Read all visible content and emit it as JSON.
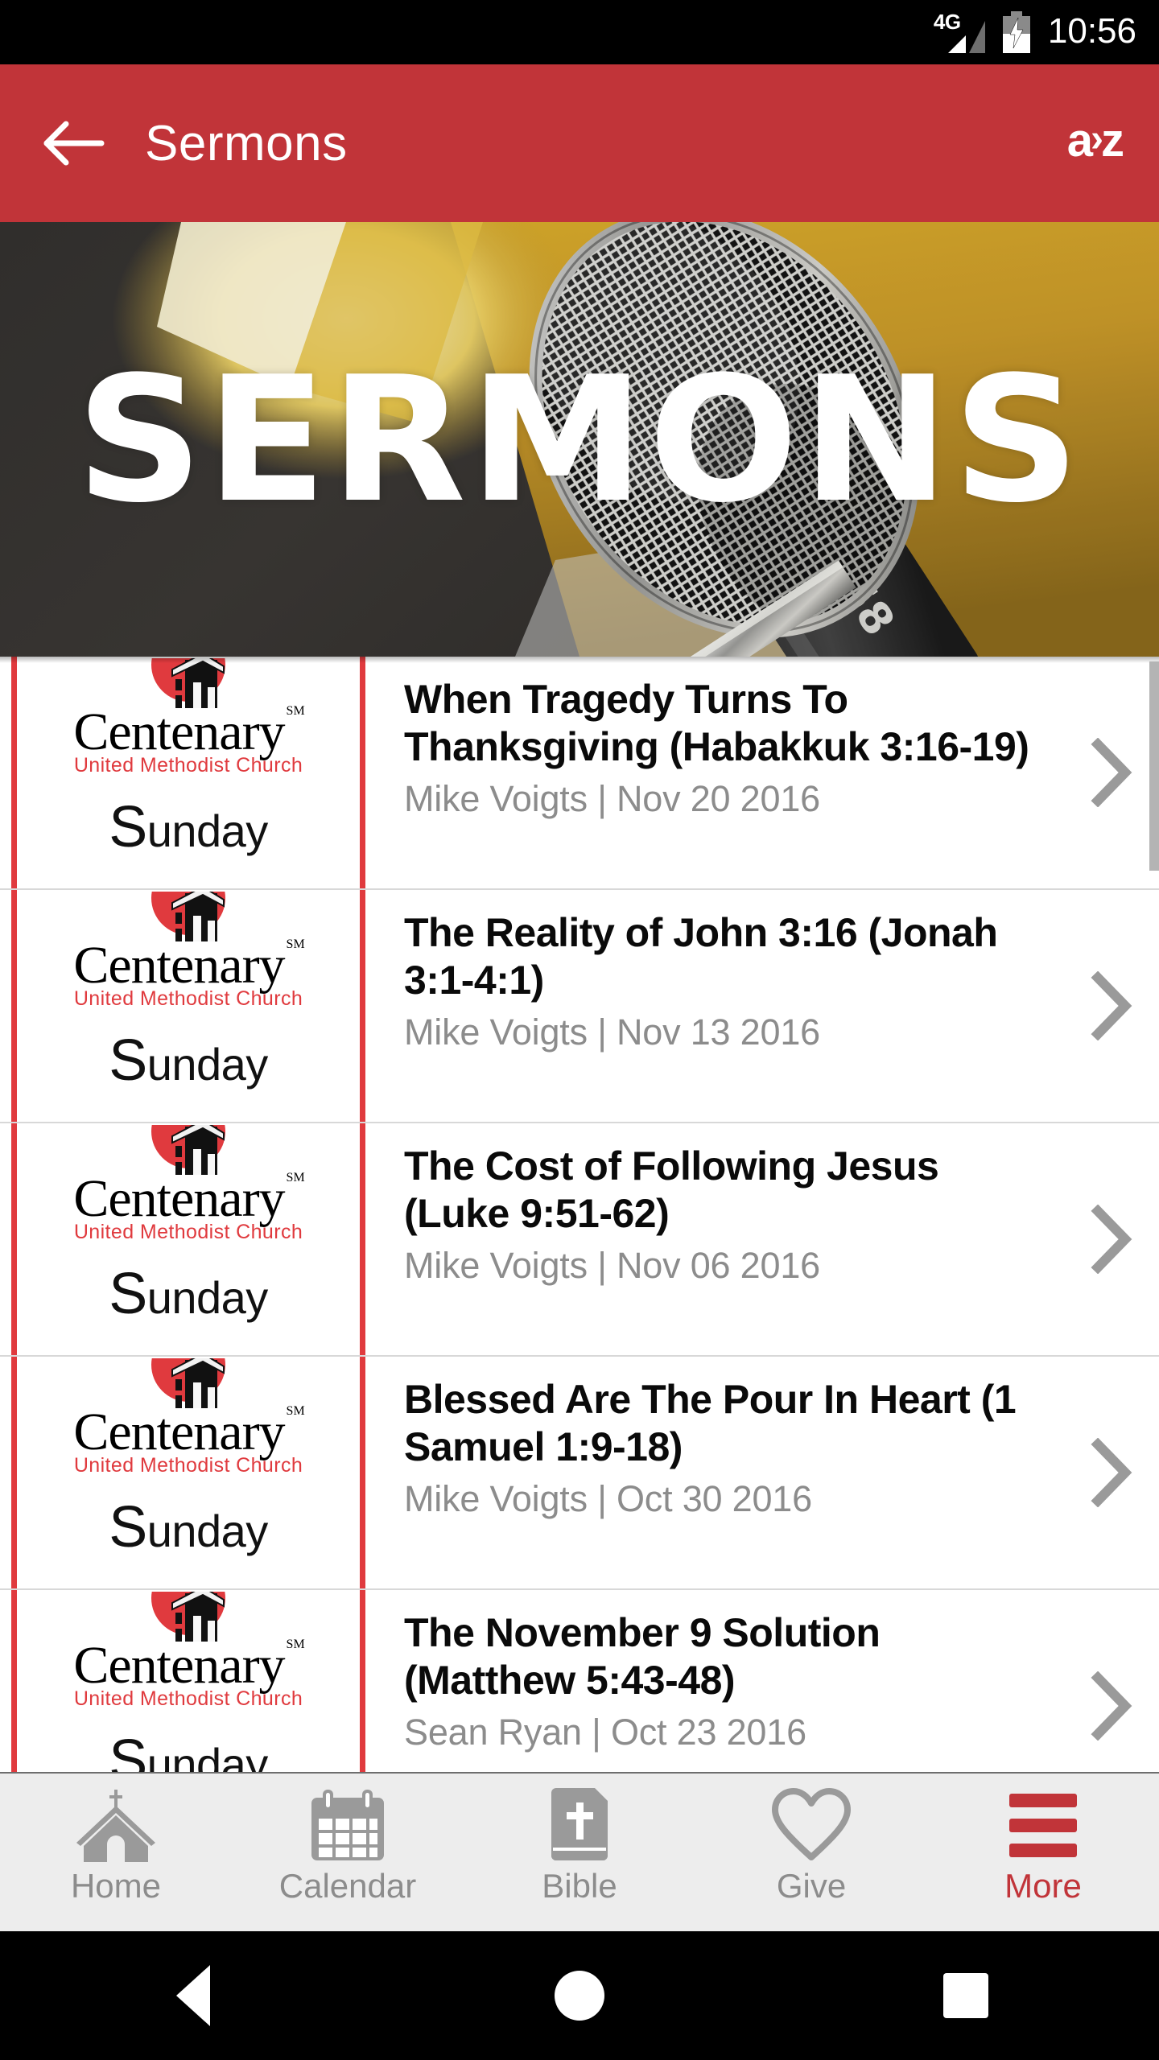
{
  "status_bar": {
    "network": "4G",
    "time": "10:56",
    "battery_icon": "battery-charging-icon",
    "signal_icon": "signal-bars-icon"
  },
  "app_bar": {
    "back_icon": "back-arrow-icon",
    "title": "Sermons",
    "sort_label_a": "a",
    "sort_label_gt": "›",
    "sort_label_z": "z",
    "background_color": "#C13439"
  },
  "hero": {
    "title": "SERMONS",
    "image_alt": "microphone-banner"
  },
  "list": {
    "chevron_icon": "chevron-right-icon",
    "logo": {
      "name": "Centenary",
      "sm": "SM",
      "subtitle": "United Methodist Church",
      "line1_cap": "S",
      "line1_rest": "unday",
      "accent_color": "#E03A3E"
    },
    "items": [
      {
        "title": "When Tragedy Turns To Thanksgiving (Habakkuk 3:16-19)",
        "meta": "Mike Voigts | Nov 20 2016"
      },
      {
        "title": "The Reality of John 3:16 (Jonah 3:1-4:1)",
        "meta": "Mike Voigts | Nov 13 2016"
      },
      {
        "title": "The Cost of Following Jesus (Luke 9:51-62)",
        "meta": "Mike Voigts | Nov 06 2016"
      },
      {
        "title": "Blessed Are The Pour In Heart (1 Samuel 1:9-18)",
        "meta": "Mike Voigts | Oct 30 2016"
      },
      {
        "title": "The November 9 Solution (Matthew 5:43-48)",
        "meta": "Sean Ryan | Oct 23 2016"
      }
    ]
  },
  "tab_bar": {
    "active_color": "#C13439",
    "inactive_color": "#8C8C8C",
    "tabs": [
      {
        "label": "Home",
        "icon": "church-icon",
        "active": false
      },
      {
        "label": "Calendar",
        "icon": "calendar-icon",
        "active": false
      },
      {
        "label": "Bible",
        "icon": "bible-icon",
        "active": false
      },
      {
        "label": "Give",
        "icon": "heart-icon",
        "active": false
      },
      {
        "label": "More",
        "icon": "hamburger-icon",
        "active": true
      }
    ]
  },
  "nav_bar": {
    "back_icon": "android-back-icon",
    "home_icon": "android-home-icon",
    "recents_icon": "android-recents-icon"
  }
}
